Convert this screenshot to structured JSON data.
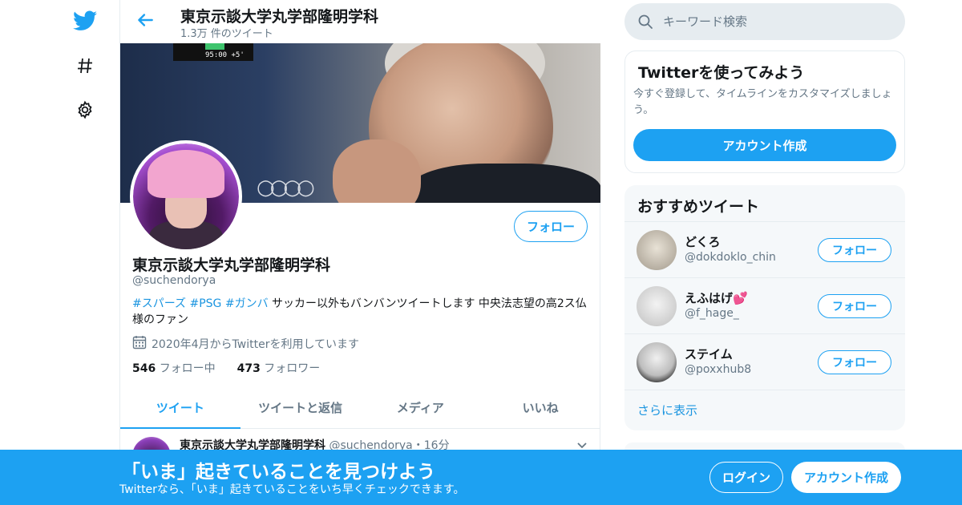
{
  "nav": {
    "icons": [
      "twitter-logo-icon",
      "hashtag-icon",
      "gear-icon"
    ]
  },
  "header": {
    "title": "東京示談大学丸学部隆明学科",
    "tweet_count": "1.3万 件のツイート"
  },
  "banner": {
    "scoreboard": "95:00 +5'"
  },
  "profile": {
    "follow_label": "フォロー",
    "name": "東京示談大学丸学部隆明学科",
    "handle": "@suchendorya",
    "bio_tags": [
      "#スパーズ",
      "#PSG",
      "#ガンバ"
    ],
    "bio_text": "サッカー以外もバンバンツイートします 中央法志望の高2ス仏様のファン",
    "joined": "2020年4月からTwitterを利用しています",
    "following_count": "546",
    "following_label": "フォロー中",
    "followers_count": "473",
    "followers_label": "フォロワー"
  },
  "tabs": [
    {
      "label": "ツイート",
      "active": true
    },
    {
      "label": "ツイートと返信",
      "active": false
    },
    {
      "label": "メディア",
      "active": false
    },
    {
      "label": "いいね",
      "active": false
    }
  ],
  "tweet": {
    "author": "東京示談大学丸学部隆明学科",
    "meta": "@suchendorya・16分"
  },
  "search": {
    "placeholder": "キーワード検索"
  },
  "signup_card": {
    "title": "Twitterを使ってみよう",
    "subtitle": "今すぐ登録して、タイムラインをカスタマイズしましょう。",
    "button": "アカウント作成"
  },
  "recommend": {
    "title": "おすすめツイート",
    "follow_label": "フォロー",
    "more": "さらに表示",
    "accounts": [
      {
        "name": "どくろ",
        "handle": "@dokdoklo_chin"
      },
      {
        "name": "えふはげ💕",
        "handle": "@f_hage_"
      },
      {
        "name": "ステイム",
        "handle": "@poxxhub8"
      }
    ]
  },
  "bottom_bar": {
    "title": "「いま」起きていることを見つけよう",
    "subtitle": "Twitterなら、「いま」起きていることをいち早くチェックできます。",
    "login": "ログイン",
    "create": "アカウント作成"
  },
  "colors": {
    "accent": "#1da1f2",
    "link": "#1b95e0",
    "muted": "#657786",
    "border": "#e6ecf0"
  }
}
